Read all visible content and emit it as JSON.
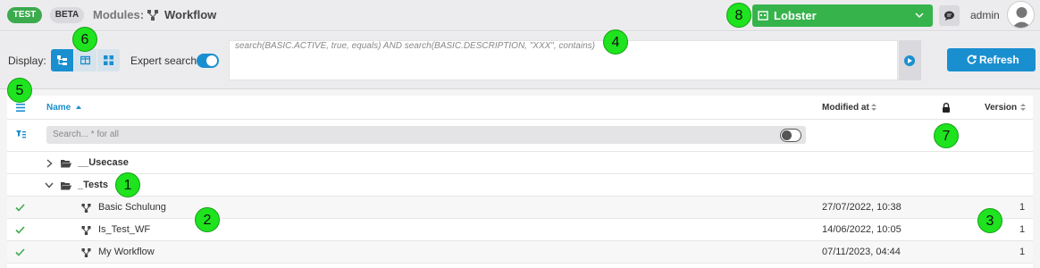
{
  "header": {
    "env_badge": "TEST",
    "stage_badge": "BETA",
    "modules_label": "Modules:",
    "module_name": "Workflow",
    "tenant": "Lobster",
    "user": "admin"
  },
  "toolbar": {
    "display_label": "Display:",
    "expert_search_label": "Expert search",
    "expert_search_enabled": true,
    "query": "search(BASIC.ACTIVE, true, equals) AND search(BASIC.DESCRIPTION, \"XXX\", contains)",
    "refresh_label": "Refresh"
  },
  "table": {
    "columns": {
      "name": "Name",
      "modified": "Modified at",
      "version": "Version"
    },
    "search_placeholder": "Search... * for all",
    "folders": [
      {
        "name": "__Usecase",
        "expanded": false
      },
      {
        "name": "_Tests",
        "expanded": true
      }
    ],
    "rows": [
      {
        "name": "Basic Schulung",
        "modified": "27/07/2022, 10:38",
        "version": "1"
      },
      {
        "name": "Is_Test_WF",
        "modified": "14/06/2022, 10:05",
        "version": "1"
      },
      {
        "name": "My Workflow",
        "modified": "07/11/2023, 04:44",
        "version": "1"
      }
    ]
  },
  "markers": [
    "1",
    "2",
    "3",
    "4",
    "5",
    "6",
    "7",
    "8"
  ],
  "colors": {
    "accent": "#1a8fd0",
    "tenant": "#36b34b",
    "badge_test": "#3cab4e",
    "marker": "#1ee31e"
  }
}
